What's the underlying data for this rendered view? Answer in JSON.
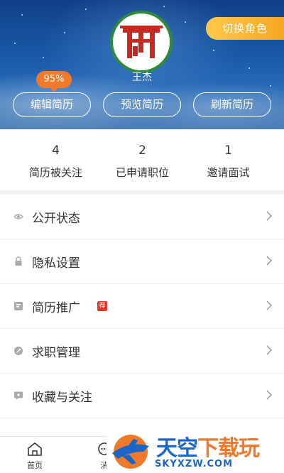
{
  "header": {
    "switch_role": "切换角色",
    "user_name": "王杰",
    "completion_badge": "95%",
    "buttons": {
      "edit_resume": "编辑简历",
      "preview_resume": "预览简历",
      "refresh_resume": "刷新简历"
    }
  },
  "stats": [
    {
      "value": "4",
      "label": "简历被关注"
    },
    {
      "value": "2",
      "label": "已申请职位"
    },
    {
      "value": "1",
      "label": "邀请面试"
    }
  ],
  "menu": {
    "items": [
      {
        "label": "公开状态",
        "icon": "eye-icon"
      },
      {
        "label": "隐私设置",
        "icon": "lock-icon"
      },
      {
        "label": "简历推广",
        "icon": "promote-icon",
        "badge": "荐"
      },
      {
        "label": "求职管理",
        "icon": "job-manage-icon"
      },
      {
        "label": "收藏与关注",
        "icon": "favorite-icon"
      }
    ]
  },
  "bottom_nav": {
    "home_label": "首页",
    "message_label": "消"
  },
  "watermark": {
    "title_part1": "天空",
    "title_part2": "下载玩",
    "subtitle": "SKYXZW.COM"
  },
  "colors": {
    "header_blue": "#1a5aa8",
    "switch_role_orange": "#f5a623",
    "badge_orange": "#f07a2a",
    "avatar_ring_green": "#2e8b3d",
    "logo_red": "#c8281e",
    "new_badge_red": "#e0392b",
    "watermark_blue": "#1a66c8"
  }
}
